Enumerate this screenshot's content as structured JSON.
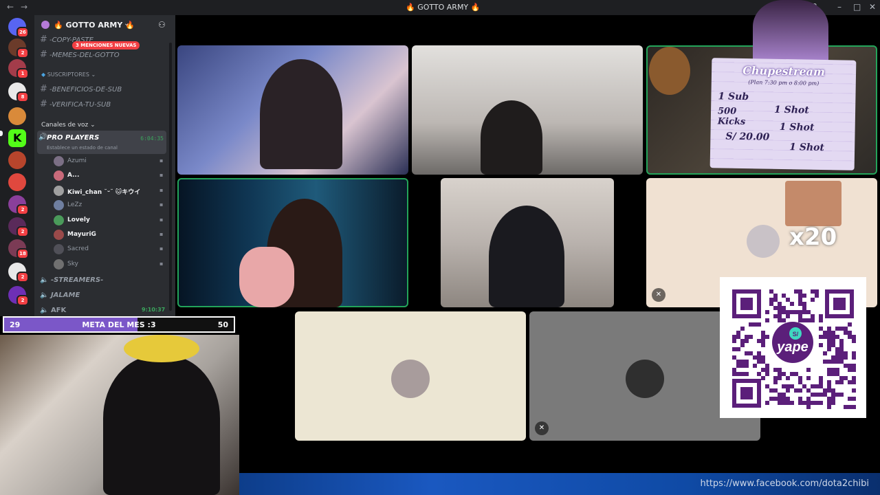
{
  "window": {
    "title": "🔥 GOTTO ARMY 🔥"
  },
  "rail": {
    "badges": [
      "26",
      "2",
      "1",
      "8",
      "2",
      "2",
      "18",
      "2",
      "2"
    ],
    "colors": {
      "discord": "#5865f2",
      "kick": "#53fc18",
      "badge": "#f23f43"
    }
  },
  "server": {
    "name": "🔥 GOTTO ARMY 🔥",
    "mention_pill": "3 MENCIONES NUEVAS"
  },
  "channels": {
    "copy_paste": "-COPY-PASTE",
    "memes": "-MEMES-DEL-GOTTO",
    "subs_category": "SUSCRIPTORES",
    "benefits": "-BENEFICIOS-DE-SUB",
    "verify": "-VERIFICA-TU-SUB",
    "voice_category": "Canales de voz"
  },
  "voice": {
    "active_channel": "PRO PLAYERS",
    "timer": "6:04:35",
    "status_prompt": "Establece un estado de canal",
    "members": [
      {
        "name": "Azumi",
        "bold": false
      },
      {
        "name": "A...",
        "bold": true
      },
      {
        "name": "Kiwi_chan ˘ᵕ˘ 🐱キウイ",
        "bold": true
      },
      {
        "name": "LeZz",
        "bold": false
      },
      {
        "name": "Lovely",
        "bold": true
      },
      {
        "name": "MayuriG",
        "bold": true
      },
      {
        "name": "Sacred",
        "bold": false
      },
      {
        "name": "Sky",
        "bold": false
      }
    ],
    "other_channels": [
      "-STREAMERS-",
      "JALAME",
      "AFK"
    ],
    "afk_timer": "9:10:37"
  },
  "goal": {
    "current": "29",
    "label": "META DEL MES :3",
    "target": "50",
    "progress": 0.58
  },
  "plan": {
    "title": "Chupestream",
    "subtitle": "(Plan 7:30 pm o 8:00 pm)",
    "row1_left": "1 Sub",
    "row1_right": "1 Shot",
    "row2_left": "500 Kicks",
    "row2_right": "1 Shot",
    "row3_left": "S/ 20.00",
    "row3_right": "1 Shot"
  },
  "tile_overlay": {
    "multiplier": "x20"
  },
  "payment": {
    "brand": "yape",
    "currency": "S/"
  },
  "banner": {
    "url": "https://www.facebook.com/dota2chibi"
  }
}
